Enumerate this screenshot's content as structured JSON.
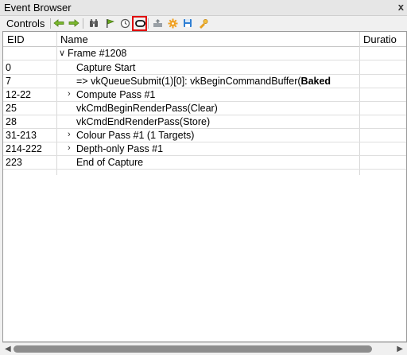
{
  "window": {
    "title": "Event Browser",
    "close_glyph": "x"
  },
  "toolbar": {
    "label": "Controls",
    "buttons": [
      {
        "icon": "go-back-arrow-icon"
      },
      {
        "icon": "go-forward-arrow-icon"
      },
      {
        "icon": "find-binoculars-icon"
      },
      {
        "icon": "bookmark-flag-icon"
      },
      {
        "icon": "time-clock-icon"
      },
      {
        "icon": "action-pill-icon"
      },
      {
        "icon": "export-icon"
      },
      {
        "icon": "settings-gear-icon"
      },
      {
        "icon": "save-disk-icon"
      },
      {
        "icon": "colorize-icon"
      }
    ],
    "highlight_color": "#e00000"
  },
  "table": {
    "columns": [
      "EID",
      "Name",
      "Duratio"
    ],
    "rows": [
      {
        "eid": "",
        "name": "Frame #1208",
        "expander": "open"
      },
      {
        "eid": "0",
        "name": "Capture Start",
        "expander": ""
      },
      {
        "eid": "7",
        "name": "=> vkQueueSubmit(1)[0]: vkBeginCommandBuffer(",
        "bold_suffix": "Baked",
        "expander": ""
      },
      {
        "eid": "12-22",
        "name": "Compute Pass #1",
        "expander": "closed"
      },
      {
        "eid": "25",
        "name": "vkCmdBeginRenderPass(Clear)",
        "expander": ""
      },
      {
        "eid": "28",
        "name": "vkCmdEndRenderPass(Store)",
        "expander": ""
      },
      {
        "eid": "31-213",
        "name": "Colour Pass #1 (1 Targets)",
        "expander": "closed"
      },
      {
        "eid": "214-222",
        "name": "Depth-only Pass #1",
        "expander": "closed"
      },
      {
        "eid": "223",
        "name": "End of Capture",
        "expander": ""
      }
    ]
  }
}
